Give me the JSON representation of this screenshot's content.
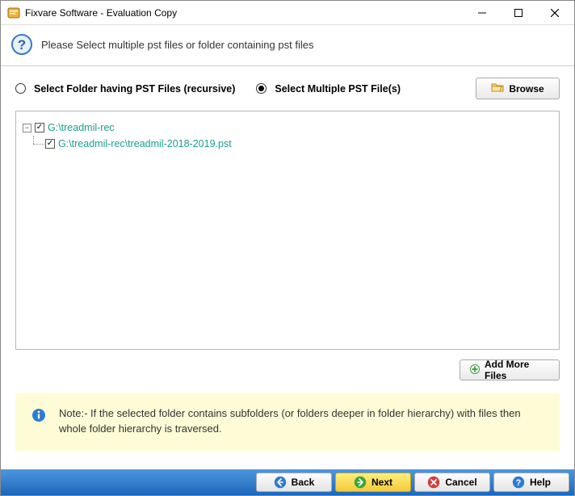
{
  "window": {
    "title": "Fixvare Software - Evaluation Copy"
  },
  "header": {
    "instruction": "Please Select multiple pst files or folder containing pst files"
  },
  "options": {
    "folder_label": "Select Folder having PST Files (recursive)",
    "multiple_label": "Select Multiple PST File(s)",
    "browse_label": "Browse"
  },
  "tree": {
    "root": "G:\\treadmil-rec",
    "file": "G:\\treadmil-rec\\treadmil-2018-2019.pst"
  },
  "add_more_label": "Add More Files",
  "note": {
    "text": "Note:- If the selected folder contains subfolders (or folders deeper in folder hierarchy) with files then whole folder hierarchy is traversed."
  },
  "footer": {
    "back": "Back",
    "next": "Next",
    "cancel": "Cancel",
    "help": "Help"
  }
}
